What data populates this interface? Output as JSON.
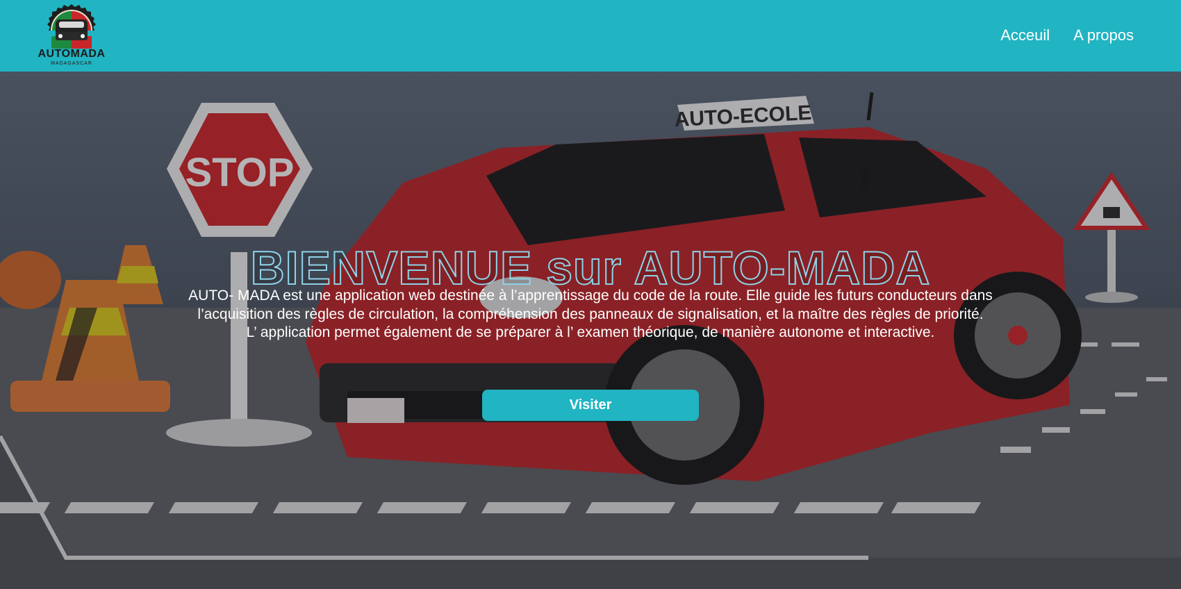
{
  "header": {
    "logo": {
      "text": "AUTOMADA",
      "subtext": "MADAGASCAR",
      "icon": "car-logo-icon"
    },
    "nav": [
      {
        "label": "Acceuil"
      },
      {
        "label": "A propos"
      }
    ]
  },
  "hero": {
    "title": "BIENVENUE sur AUTO-MADA",
    "description_lines": [
      "AUTO- MADA est une application web destinée à l’apprentissage du code de la route. Elle guide les futurs conducteurs dans",
      "l’acquisition des règles de circulation, la compréhension des panneaux de signalisation, et la maître des règles de priorité.",
      "L’ application permet également de se préparer à l’ examen théorique, de manière autonome et interactive."
    ],
    "button_label": "Visiter",
    "background_signs": {
      "stop": "STOP",
      "roof_sign": "AUTO-ECOLE"
    }
  },
  "colors": {
    "accent": "#21b4c2",
    "title_outline": "#8fd3e8",
    "car": "#b8262a"
  }
}
